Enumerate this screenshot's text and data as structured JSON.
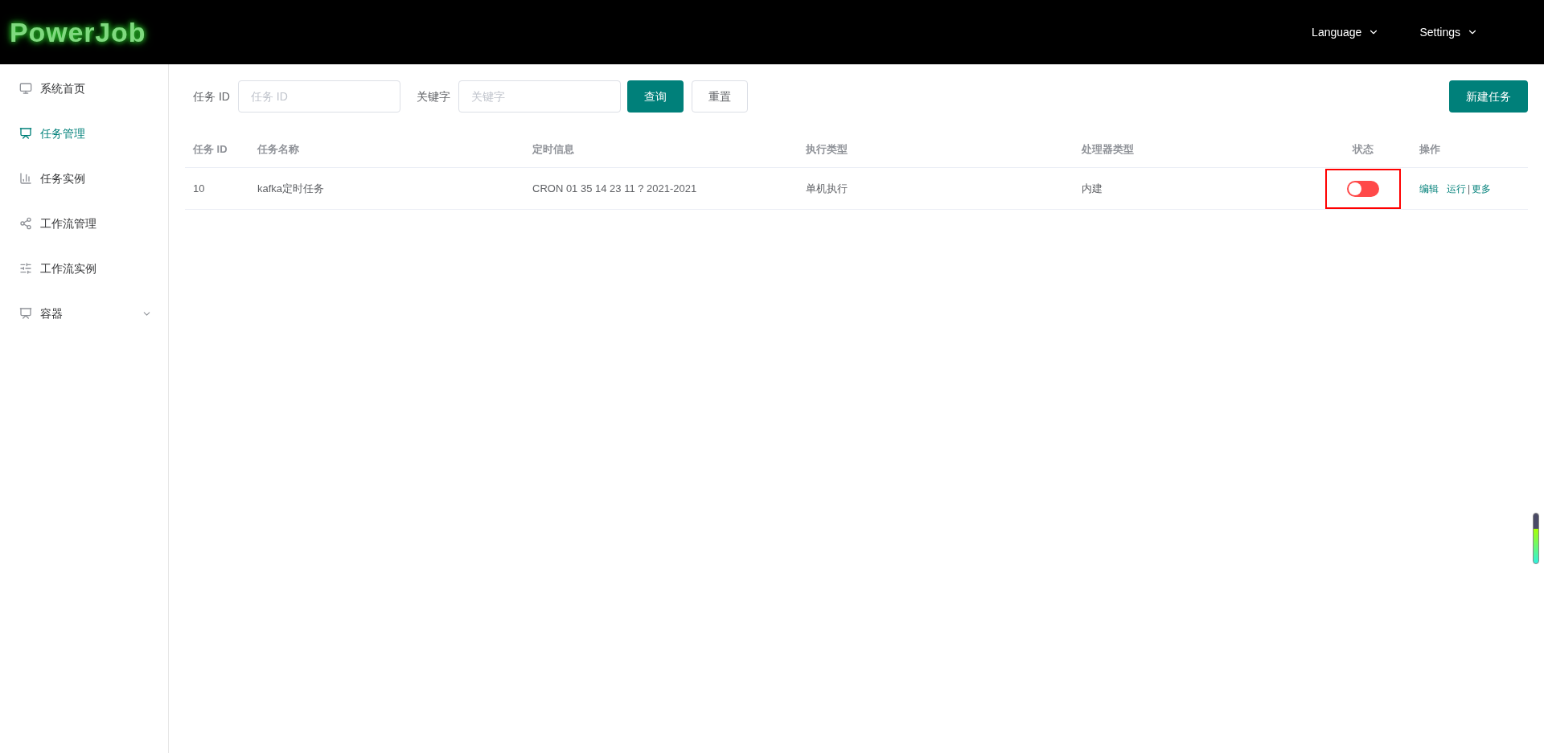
{
  "header": {
    "logo": "PowerJob",
    "menus": [
      {
        "label": "Language"
      },
      {
        "label": "Settings"
      }
    ]
  },
  "sidebar": {
    "items": [
      {
        "label": "系统首页",
        "kind": "monitor",
        "selected": false,
        "expandable": false
      },
      {
        "label": "任务管理",
        "kind": "board",
        "selected": true,
        "expandable": false
      },
      {
        "label": "任务实例",
        "kind": "bars",
        "selected": false,
        "expandable": false
      },
      {
        "label": "工作流管理",
        "kind": "share",
        "selected": false,
        "expandable": false
      },
      {
        "label": "工作流实例",
        "kind": "sliders",
        "selected": false,
        "expandable": false
      },
      {
        "label": "容器",
        "kind": "board",
        "selected": false,
        "expandable": true
      }
    ]
  },
  "filters": [
    {
      "label": "任务 ID",
      "placeholder": "任务 ID"
    },
    {
      "label": "关键字",
      "placeholder": "关键字"
    }
  ],
  "buttons": {
    "query": "查询",
    "reset": "重置",
    "create": "新建任务"
  },
  "table": {
    "columns": [
      "任务 ID",
      "任务名称",
      "定时信息",
      "执行类型",
      "处理器类型",
      "状态",
      "操作"
    ],
    "rows": [
      {
        "id": "10",
        "name": "kafka定时任务",
        "schedule": "CRON 01 35 14 23 11 ? 2021-2021",
        "exec_type": "单机执行",
        "processor": "内建",
        "enabled": false,
        "highlighted": true,
        "actions": [
          "编辑",
          "运行",
          "更多"
        ],
        "separator": "|"
      }
    ]
  }
}
